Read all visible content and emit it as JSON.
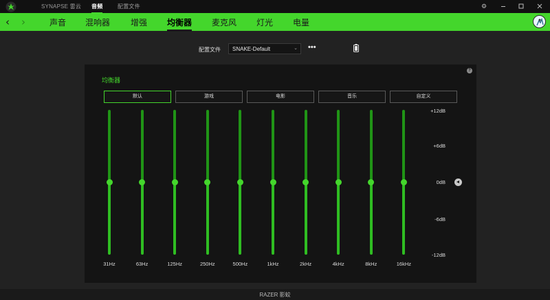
{
  "titlebar": {
    "tabs": [
      {
        "label": "SYNAPSE 雷云"
      },
      {
        "label": "音频"
      },
      {
        "label": "配置文件"
      }
    ],
    "active_tab": 1
  },
  "nav": {
    "back_icon": "chevron-left-icon",
    "forward_icon": "chevron-right-icon",
    "items": [
      {
        "label": "声音"
      },
      {
        "label": "混响器"
      },
      {
        "label": "增强"
      },
      {
        "label": "均衡器"
      },
      {
        "label": "麦克风"
      },
      {
        "label": "灯光"
      },
      {
        "label": "电量"
      }
    ],
    "active_item": 3
  },
  "profile": {
    "label": "配置文件",
    "value": "SNAKE-Default",
    "more_label": "•••"
  },
  "equalizer": {
    "title": "均衡器",
    "presets": [
      {
        "label": "默认"
      },
      {
        "label": "游戏"
      },
      {
        "label": "电影"
      },
      {
        "label": "音乐"
      },
      {
        "label": "自定义"
      }
    ],
    "active_preset": 0,
    "bands": [
      {
        "freq": "31Hz",
        "gain_db": 0
      },
      {
        "freq": "63Hz",
        "gain_db": 0
      },
      {
        "freq": "125Hz",
        "gain_db": 0
      },
      {
        "freq": "250Hz",
        "gain_db": 0
      },
      {
        "freq": "500Hz",
        "gain_db": 0
      },
      {
        "freq": "1kHz",
        "gain_db": 0
      },
      {
        "freq": "2kHz",
        "gain_db": 0
      },
      {
        "freq": "4kHz",
        "gain_db": 0
      },
      {
        "freq": "8kHz",
        "gain_db": 0
      },
      {
        "freq": "16kHz",
        "gain_db": 0
      }
    ],
    "db_scale": [
      "+12dB",
      "+6dB",
      "0dB",
      "-6dB",
      "-12dB"
    ],
    "gain_range": [
      -12,
      12
    ]
  },
  "footer": {
    "text": "RAZER 影蛟"
  },
  "colors": {
    "accent": "#44d62c",
    "background": "#222222",
    "panel": "#141414"
  }
}
